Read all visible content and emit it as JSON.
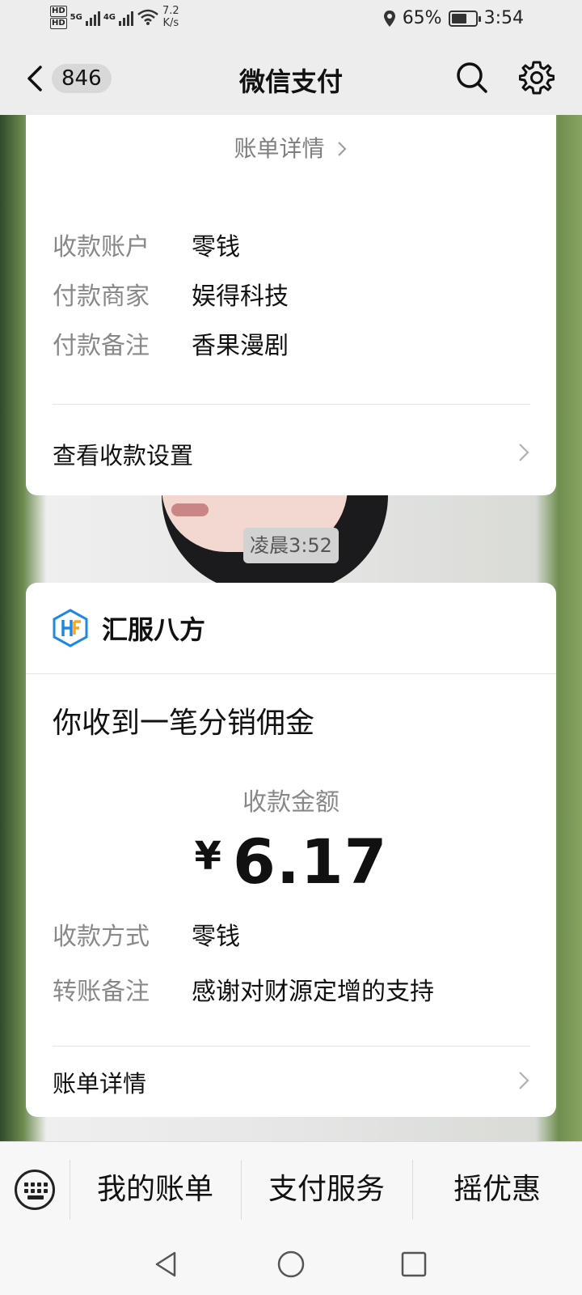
{
  "status_bar": {
    "hd1": "HD",
    "hd2": "HD",
    "net1": "5G",
    "net2": "4G",
    "speed_value": "7.2",
    "speed_unit": "K/s",
    "battery_percent": "65%",
    "battery_level": 0.65,
    "time": "3:54"
  },
  "nav": {
    "unread_count": "846",
    "title": "微信支付",
    "icons": [
      "back-arrow-icon",
      "search-icon",
      "gear-icon"
    ]
  },
  "card1": {
    "bill_link": "账单详情",
    "rows": [
      {
        "label": "收款账户",
        "value": "零钱"
      },
      {
        "label": "付款商家",
        "value": "娱得科技"
      },
      {
        "label": "付款备注",
        "value": "香果漫剧"
      }
    ],
    "settings_link": "查看收款设置"
  },
  "timestamp": "凌晨3:52",
  "card2": {
    "brand_name": "汇服八方",
    "brand_colors": [
      "#1e88e5",
      "#f5a623"
    ],
    "headline": "你收到一笔分销佣金",
    "amount_label": "收款金额",
    "currency": "¥",
    "amount": "6.17",
    "rows": [
      {
        "label": "收款方式",
        "value": "零钱"
      },
      {
        "label": "转账备注",
        "value": "感谢对财源定增的支持"
      }
    ],
    "bill_link": "账单详情"
  },
  "menu": {
    "items": [
      "我的账单",
      "支付服务",
      "摇优惠"
    ]
  }
}
